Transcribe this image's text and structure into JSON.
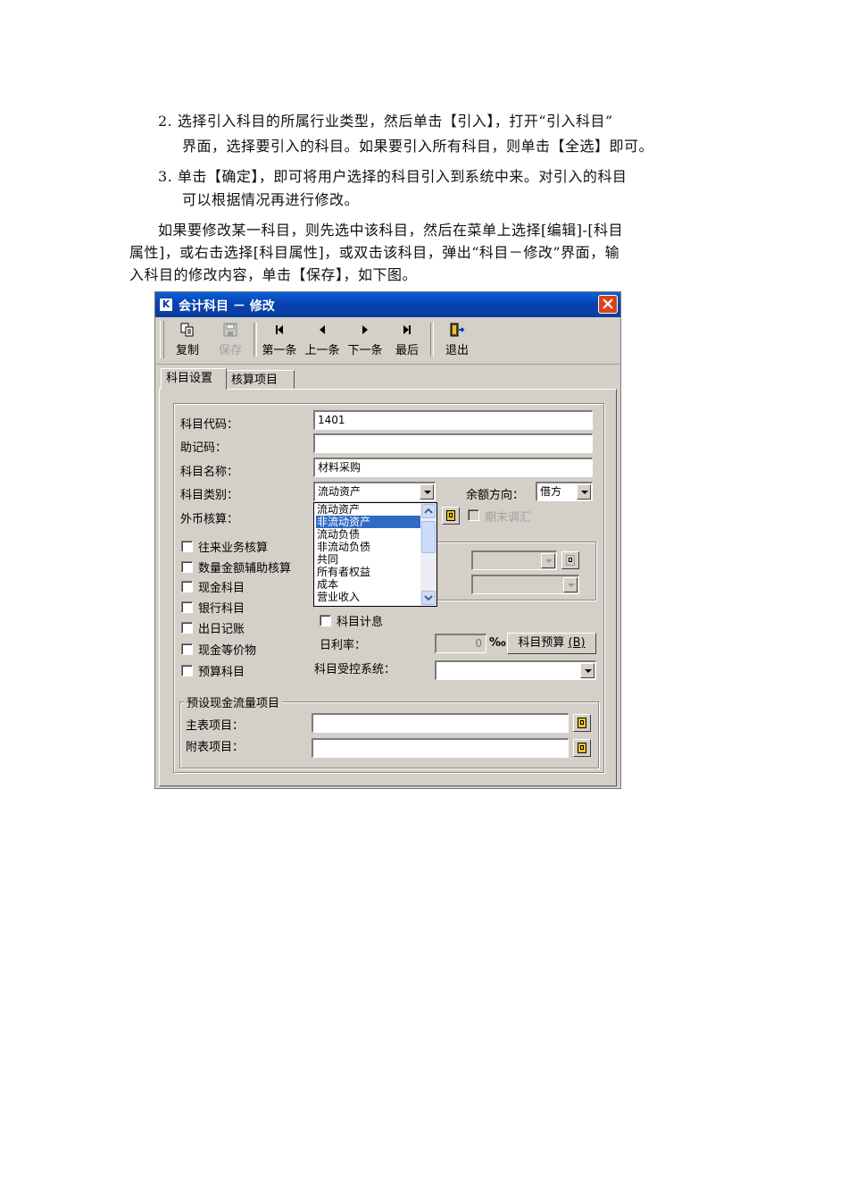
{
  "document": {
    "step2_line1": "2.  选择引入科目的所属行业类型，然后单击【引入】，打开“引入科目”",
    "step2_line2": "界面，选择要引入的科目。如果要引入所有科目，则单击【全选】即可。",
    "step3_line1": "3.  单击【确定】，即可将用户选择的科目引入到系统中来。对引入的科目",
    "step3_line2": "可以根据情况再进行修改。",
    "para_line1": "如果要修改某一科目，则先选中该科目，然后在菜单上选择[编辑]-[科目",
    "para_line2": "属性]，或右击选择[科目属性]，或双击该科目，弹出“科目－修改”界面，输",
    "para_line3": "入科目的修改内容，单击【保存】，如下图。"
  },
  "dialog": {
    "title": "会计科目 － 修改",
    "toolbar": {
      "copy": "复制",
      "save": "保存",
      "first": "第一条",
      "prev": "上一条",
      "next": "下一条",
      "last": "最后",
      "exit": "退出"
    },
    "tabs": [
      "科目设置",
      "核算项目"
    ],
    "fields": {
      "code_label": "科目代码：",
      "code_value": "1401",
      "mnemonic_label": "助记码：",
      "mnemonic_value": "",
      "name_label": "科目名称：",
      "name_value": "材料采购",
      "category_label": "科目类别：",
      "category_value": "流动资产",
      "balance_dir_label": "余额方向：",
      "balance_dir_value": "借方",
      "forex_label": "外币核算：",
      "period_end_adjust": "期末调汇",
      "interest": "科目计息",
      "daily_rate_label": "日利率：",
      "daily_rate_value": "0",
      "per_mille": "‰",
      "budget_button": "科目预算",
      "budget_hotkey": "(B)",
      "control_system_label": "科目受控系统："
    },
    "checkboxes": [
      "往来业务核算",
      "数量金额辅助核算",
      "现金科目",
      "银行科目",
      "出日记账",
      "现金等价物",
      "预算科目"
    ],
    "category_options": [
      "流动资产",
      "非流动资产",
      "流动负债",
      "非流动负债",
      "共同",
      "所有者权益",
      "成本",
      "营业收入"
    ],
    "category_selected_index": 1,
    "cashflow": {
      "group_title": "预设现金流量项目",
      "main_label": "主表项目：",
      "main_value": "",
      "sub_label": "附表项目：",
      "sub_value": ""
    },
    "colors": {
      "titlebar": "#0a52c9",
      "face": "#d4d0c8",
      "selection": "#316ac5",
      "close": "#d9421b"
    }
  }
}
